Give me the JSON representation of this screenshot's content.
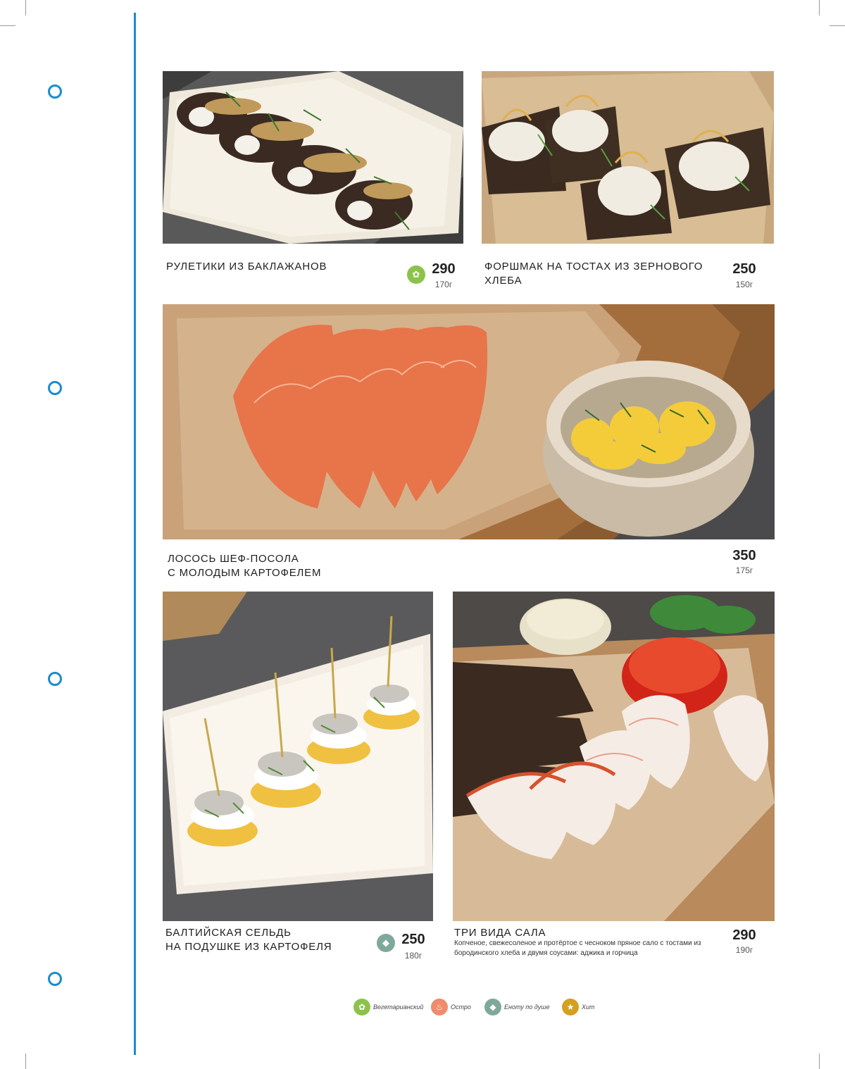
{
  "colors": {
    "rail": "#1a8ccf",
    "vegetarian": "#8bc34a",
    "spicy": "#ef8c6b",
    "raccoon": "#7fa89c",
    "hit": "#d4a020"
  },
  "dishes": [
    {
      "title": "РУЛЕТИКИ ИЗ БАКЛАЖАНОВ",
      "price": "290",
      "weight": "170г",
      "badge_icon": "vegetarian-icon"
    },
    {
      "title": "ФОРШМАК НА ТОСТАХ ИЗ ЗЕРНОВОГО ХЛЕБА",
      "price": "250",
      "weight": "150г"
    },
    {
      "title_line1": "ЛОСОСЬ ШЕФ-ПОСОЛА",
      "title_line2": "С МОЛОДЫМ КАРТОФЕЛЕМ",
      "price": "350",
      "weight": "175г"
    },
    {
      "title_line1": "БАЛТИЙСКАЯ СЕЛЬДЬ",
      "title_line2": "НА ПОДУШКЕ ИЗ КАРТОФЕЛЯ",
      "price": "250",
      "weight": "180г",
      "badge_icon": "raccoon-icon"
    },
    {
      "title": "ТРИ ВИДА САЛА",
      "description": "Копченое, свежесоленое и протёртое с чесноком пряное сало с тостами из бородинского хлеба и двумя соусами: аджика и горчица",
      "price": "290",
      "weight": "190г"
    }
  ],
  "legend": [
    {
      "icon": "vegetarian-icon",
      "label": "Вегетарианский"
    },
    {
      "icon": "spicy-icon",
      "label": "Остро"
    },
    {
      "icon": "raccoon-icon",
      "label": "Еноту по душе"
    },
    {
      "icon": "hit-icon",
      "label": "Хит"
    }
  ]
}
